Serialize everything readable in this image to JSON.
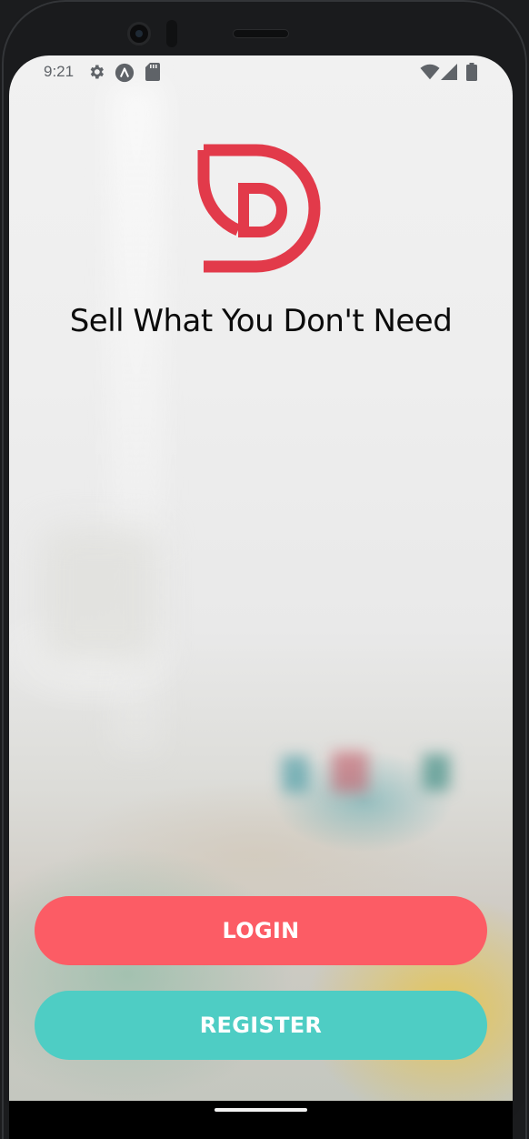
{
  "status_bar": {
    "time": "9:21",
    "left_icons": [
      "gear-icon",
      "accessibility-icon",
      "sd-card-icon"
    ],
    "right_icons": [
      "wifi-icon",
      "signal-icon",
      "battery-icon"
    ]
  },
  "brand": {
    "logo": "d-logo-icon",
    "tagline": "Sell What You Don't Need",
    "accent_color": "#e23a4a"
  },
  "actions": {
    "login_label": "LOGIN",
    "login_color": "#fc5c65",
    "register_label": "REGISTER",
    "register_color": "#4ecdc4"
  }
}
